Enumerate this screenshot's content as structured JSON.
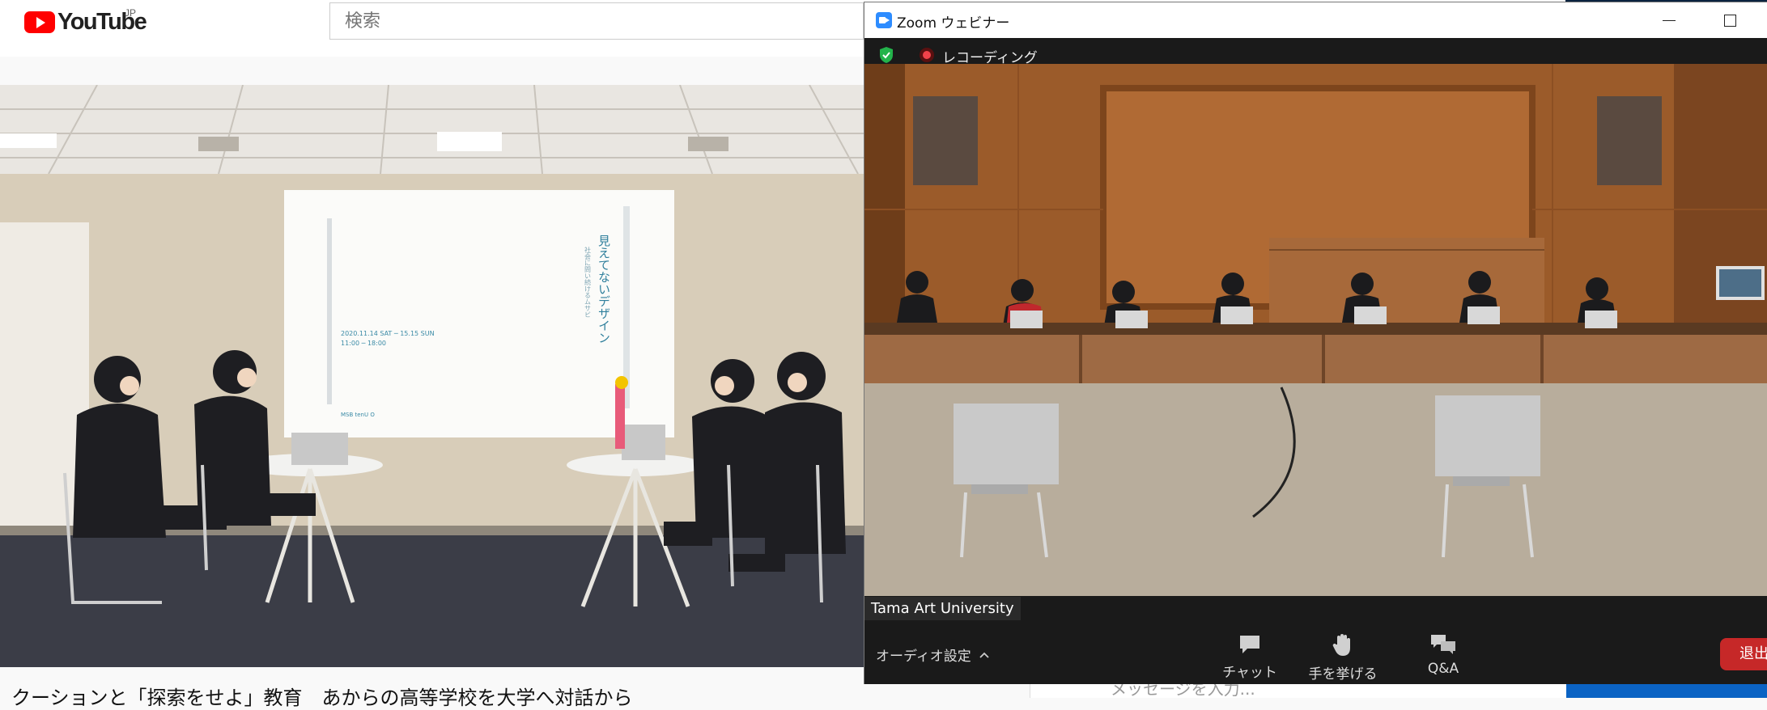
{
  "youtube": {
    "logo_text": "YouTube",
    "country_code": "JP",
    "search_placeholder": "検索",
    "video_title": "クーションと「探索をせよ」教育　あからの高等学校を大学へ対話から"
  },
  "poster": {
    "title": "見えてないデザイン",
    "subtitle": "社会に問い続けるムサビ",
    "date": "2020.11.14 SAT ─ 15.15 SUN",
    "time": "11:00 ─ 18:00",
    "logos": "MSB   tenU   O"
  },
  "zoom": {
    "window_title": "Zoom ウェビナー",
    "recording_label": "レコーディング",
    "participant_name": "Tama Art University",
    "audio_settings_label": "オーディオ設定",
    "tools": [
      {
        "label": "チャット",
        "icon": "chat-icon"
      },
      {
        "label": "手を挙げる",
        "icon": "raise-hand-icon"
      },
      {
        "label": "Q&A",
        "icon": "qa-icon"
      }
    ],
    "leave_label": "退出"
  },
  "side": {
    "message_placeholder": "メッセージを入力..."
  },
  "colors": {
    "youtube_red": "#ff0000",
    "zoom_blue": "#2d8cff",
    "leave_red": "#c62828",
    "security_green": "#23b34b",
    "recording_red": "#f0424a",
    "zoom_dark": "#1a1a1a"
  }
}
